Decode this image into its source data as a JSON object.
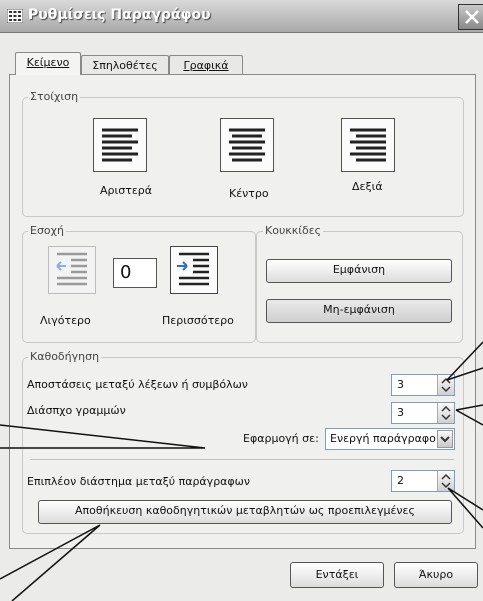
{
  "window": {
    "title": "Ρυθμίσεις Παραγράφου"
  },
  "tabs": [
    {
      "label": "Κείμενο",
      "active": true
    },
    {
      "label": "Σπηλοθέτες",
      "active": false
    },
    {
      "label": "Γραφικά",
      "active": false
    }
  ],
  "alignment": {
    "legend": "Στοίχιση",
    "left_label": "Αριστερά",
    "center_label": "Κέντρο",
    "right_label": "Δεξιά"
  },
  "indent": {
    "legend": "Εσοχή",
    "value": "0",
    "less_label": "Λιγότερο",
    "more_label": "Περισσότερο"
  },
  "bullets": {
    "legend": "Κουκκίδες",
    "show_button": "Εμφάνιση",
    "hide_button": "Μη-εμφάνιση"
  },
  "spacing": {
    "legend": "Καθοδήγηση",
    "word_spacing_label": "Αποστάσεις μεταξύ λέξεων ή συμβόλων",
    "word_spacing_value": "3",
    "line_spacing_label": "Διάσπχο γραμμών",
    "line_spacing_value": "3",
    "apply_to_label": "Εφαρμογή σε:",
    "apply_to_value": "Ενεργή παράγραφο",
    "paragraph_spacing_label": "Επιπλέον διάστημα μεταξύ παράγραφων",
    "paragraph_spacing_value": "2",
    "save_defaults_button": "Αποθήκευση καθοδηγητικών μεταβλητών ως προεπιλεγμένες"
  },
  "footer": {
    "ok_button": "Εντάξει",
    "cancel_button": "Άκυρο"
  },
  "colors": {
    "titlebar_text": "#ffffff",
    "panel_bg": "#f0f0ee",
    "dialog_bg": "#ebebe9"
  }
}
